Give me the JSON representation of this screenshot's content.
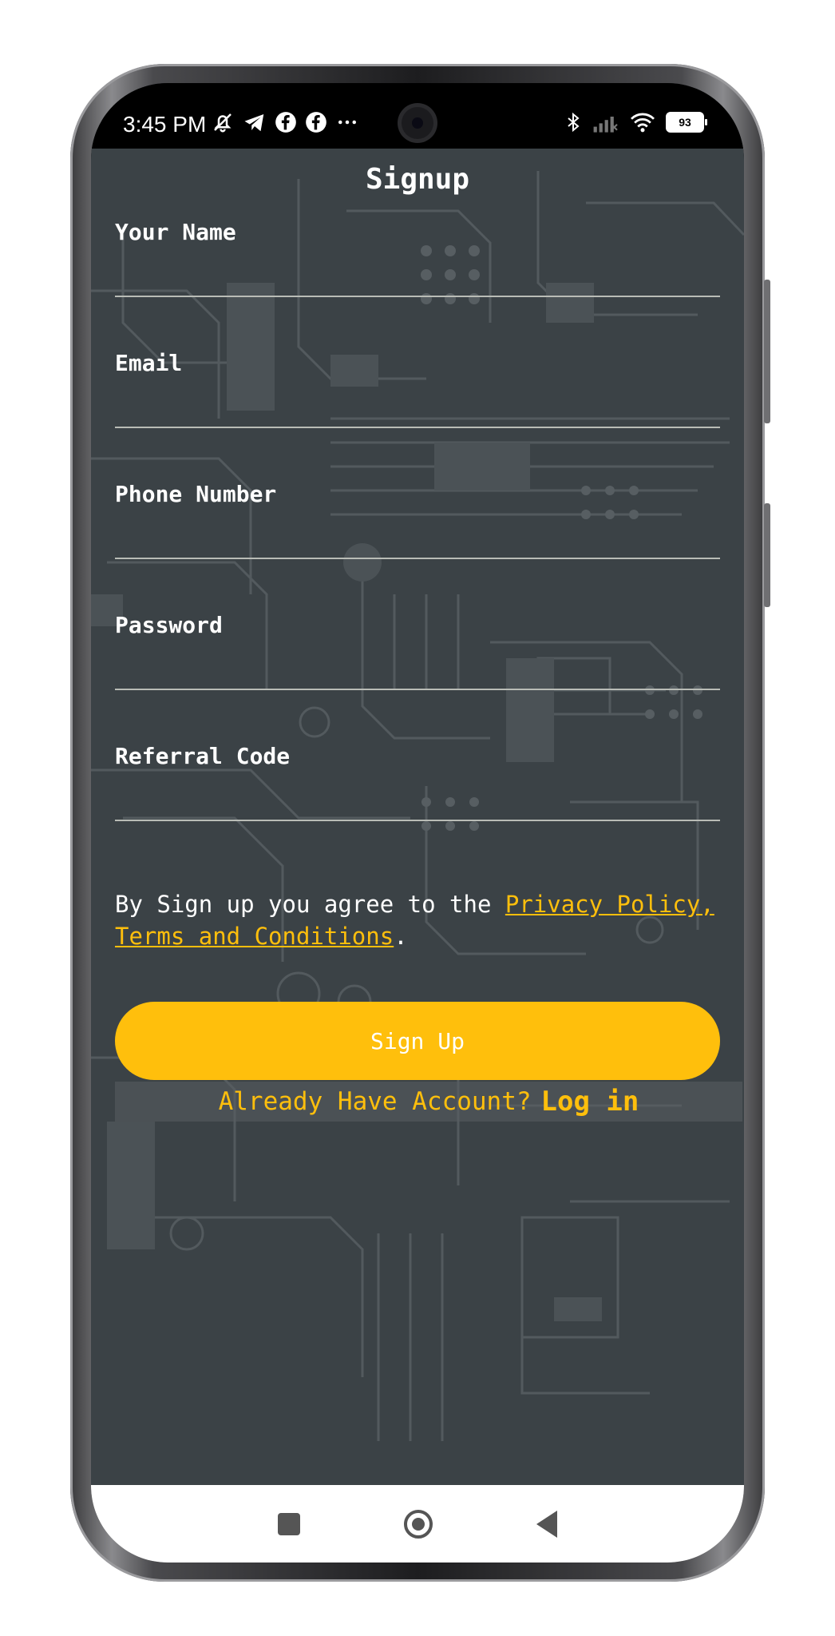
{
  "status_bar": {
    "time": "3:45 PM",
    "battery": "93",
    "left_icons": [
      "bell-off-icon",
      "telegram-icon",
      "facebook-icon",
      "facebook-icon",
      "more-dots-icon"
    ],
    "right_icons": [
      "bluetooth-icon",
      "signal-icon",
      "wifi-icon",
      "battery-icon"
    ]
  },
  "page": {
    "title": "Signup"
  },
  "form": {
    "fields": [
      {
        "label": "Your Name",
        "value": ""
      },
      {
        "label": "Email",
        "value": ""
      },
      {
        "label": "Phone Number",
        "value": ""
      },
      {
        "label": "Password",
        "value": ""
      },
      {
        "label": "Referral Code",
        "value": ""
      }
    ],
    "terms_prefix": "By Sign up you agree to the ",
    "privacy_link": "Privacy Policy,",
    "terms_link": "Terms and Conditions",
    "terms_suffix": ".",
    "signup_button": "Sign Up",
    "already_text": "Already Have Account?",
    "login_link": "Log in"
  },
  "colors": {
    "accent": "#ffbf0c",
    "background": "#3b4246",
    "circuit": "#535a5e"
  },
  "nav_bar": {
    "buttons": [
      "recents-square-icon",
      "home-circle-icon",
      "back-triangle-icon"
    ]
  }
}
